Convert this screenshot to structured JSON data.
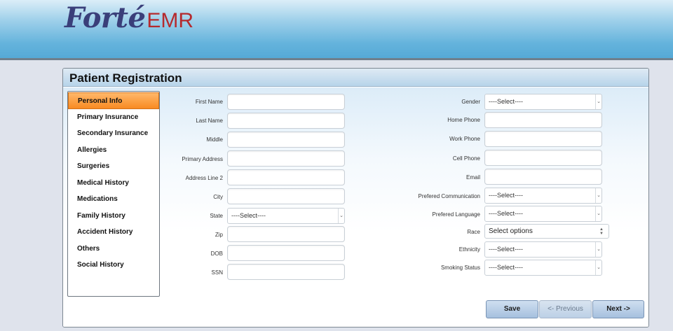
{
  "header": {
    "logo_main": "Forté",
    "logo_suffix": "EMR"
  },
  "panel": {
    "title": "Patient Registration"
  },
  "sidenav": {
    "items": [
      {
        "label": "Personal Info",
        "active": true
      },
      {
        "label": "Primary Insurance"
      },
      {
        "label": "Secondary Insurance"
      },
      {
        "label": "Allergies"
      },
      {
        "label": "Surgeries"
      },
      {
        "label": "Medical History"
      },
      {
        "label": "Medications"
      },
      {
        "label": "Family History"
      },
      {
        "label": "Accident History"
      },
      {
        "label": "Others"
      },
      {
        "label": "Social History"
      }
    ]
  },
  "form_left": {
    "first_name": {
      "label": "First Name",
      "value": ""
    },
    "last_name": {
      "label": "Last Name",
      "value": ""
    },
    "middle": {
      "label": "Middle",
      "value": ""
    },
    "primary_address": {
      "label": "Primary Address",
      "value": ""
    },
    "address_line2": {
      "label": "Address Line 2",
      "value": ""
    },
    "city": {
      "label": "City",
      "value": ""
    },
    "state": {
      "label": "State",
      "selected": "----Select----"
    },
    "zip": {
      "label": "Zip",
      "value": ""
    },
    "dob": {
      "label": "DOB",
      "value": ""
    },
    "ssn": {
      "label": "SSN",
      "value": ""
    }
  },
  "form_right": {
    "gender": {
      "label": "Gender",
      "selected": "----Select----"
    },
    "home_phone": {
      "label": "Home Phone",
      "value": ""
    },
    "work_phone": {
      "label": "Work Phone",
      "value": ""
    },
    "cell_phone": {
      "label": "Cell Phone",
      "value": ""
    },
    "email": {
      "label": "Email",
      "value": ""
    },
    "pref_comm": {
      "label": "Prefered Communication",
      "selected": "----Select----"
    },
    "pref_lang": {
      "label": "Prefered Language",
      "selected": "----Select----"
    },
    "race": {
      "label": "Race",
      "selected": "Select options"
    },
    "ethnicity": {
      "label": "Ethnicity",
      "selected": "----Select----"
    },
    "smoking": {
      "label": "Smoking Status",
      "selected": "----Select----"
    }
  },
  "buttons": {
    "save": "Save",
    "previous": "<- Previous",
    "next": "Next ->"
  },
  "icons": {
    "select_caret": "chevron-down-icon",
    "race_caret": "up-down-arrows-icon"
  },
  "colors": {
    "active_tab": "#f88a22",
    "logo_blue": "#3a3f7a",
    "logo_red": "#b52a2e",
    "header_blue": "#64b3dc"
  }
}
